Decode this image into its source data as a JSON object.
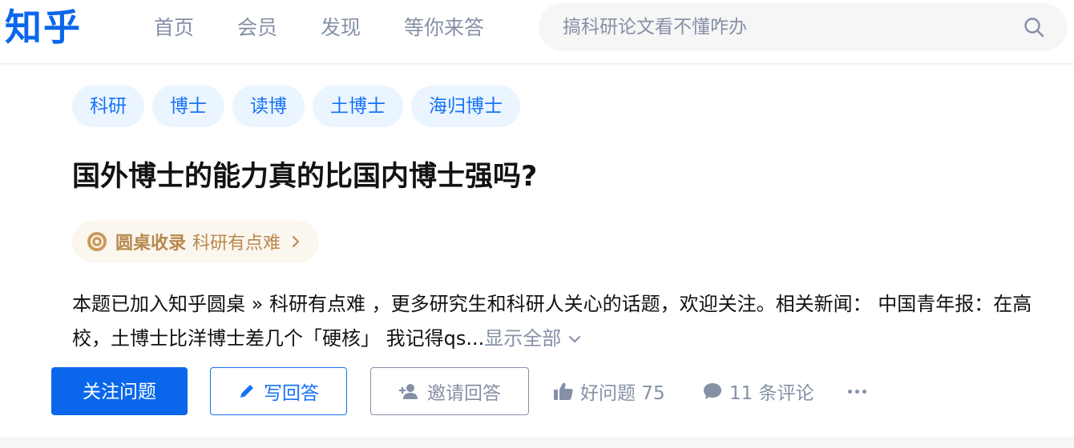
{
  "header": {
    "logo": "知乎",
    "nav": [
      "首页",
      "会员",
      "发现",
      "等你来答"
    ],
    "search_placeholder": "搞科研论文看不懂咋办"
  },
  "question": {
    "tags": [
      "科研",
      "博士",
      "读博",
      "土博士",
      "海归博士"
    ],
    "title": "国外博士的能力真的比国内博士强吗?",
    "roundtable": {
      "label": "圆桌收录",
      "name": "科研有点难"
    },
    "detail": "本题已加入知乎圆桌 » 科研有点难 ，更多研究生和科研人关心的话题，欢迎关注。相关新闻： 中国青年报：在高校，土博士比洋博士差几个「硬核」 我记得qs...",
    "show_all": "显示全部"
  },
  "actions": {
    "follow": "关注问题",
    "answer": "写回答",
    "invite": "邀请回答",
    "good_question": "好问题 75",
    "comments": "11 条评论"
  },
  "colors": {
    "brand": "#0a67ec",
    "tag_bg": "#ebf5ff",
    "tag_text": "#1772f6",
    "roundtable_text": "#b8894d",
    "muted": "#8590a6"
  },
  "icons": [
    "search-icon",
    "roundtable-icon",
    "chevron-right-icon",
    "chevron-down-icon",
    "pencil-icon",
    "add-person-icon",
    "thumbs-up-icon",
    "comment-icon",
    "more-icon"
  ]
}
